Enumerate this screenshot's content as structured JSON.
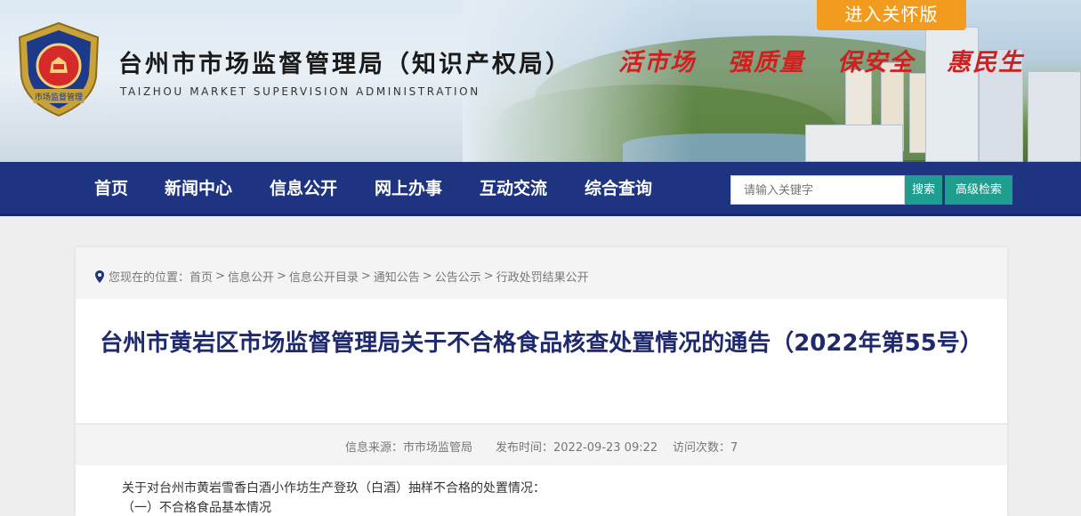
{
  "header": {
    "site_name": "台州市市场监督管理局（知识产权局）",
    "site_name_en": "TAIZHOU MARKET SUPERVISION ADMINISTRATION",
    "logo_text": "市场监督管理",
    "slogans": [
      "活市场",
      "强质量",
      "保安全",
      "惠民生"
    ],
    "care_mode_label": "进入关怀版",
    "colors": {
      "slogan": "#d01f1f",
      "care_button": "#f29c1f"
    }
  },
  "nav": {
    "items": [
      "首页",
      "新闻中心",
      "信息公开",
      "网上办事",
      "互动交流",
      "综合查询"
    ],
    "search_placeholder": "请输入关键字",
    "search_label": "搜索",
    "advanced_label": "高级检索",
    "colors": {
      "background": "#1f3481",
      "button": "#1f9e8f"
    }
  },
  "breadcrumb": {
    "prefix": "您现在的位置：",
    "items": [
      "首页",
      "信息公开",
      "信息公开目录",
      "通知公告",
      "公告公示",
      "行政处罚结果公开"
    ]
  },
  "article": {
    "title": "台州市黄岩区市场监督管理局关于不合格食品核查处置情况的通告（2022年第55号）",
    "source": "信息来源：市市场监管局",
    "publish_time": "发布时间：2022-09-23 09:22",
    "views": "访问次数：7",
    "paragraphs": [
      "关于对台州市黄岩雪香白酒小作坊生产登玖（白酒）抽样不合格的处置情况：",
      "（一）不合格食品基本情况"
    ]
  }
}
